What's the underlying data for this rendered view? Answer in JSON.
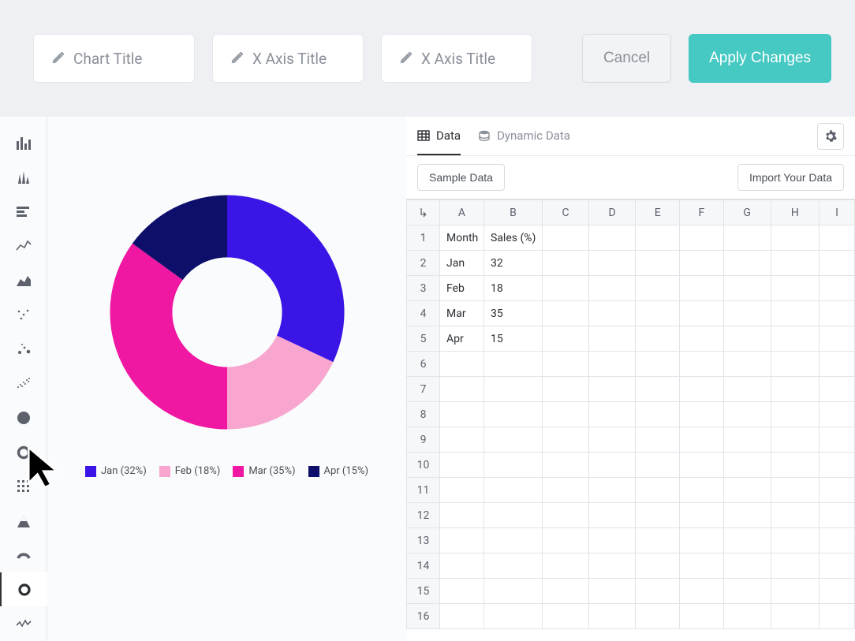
{
  "topbar": {
    "chart_title_placeholder": "Chart Title",
    "x_axis_placeholder": "X Axis Title",
    "y_axis_placeholder": "X Axis Title",
    "cancel_label": "Cancel",
    "apply_label": "Apply Changes"
  },
  "tabs": {
    "data": "Data",
    "dynamic": "Dynamic Data"
  },
  "toolbar": {
    "sample": "Sample Data",
    "import": "Import Your Data"
  },
  "sheet": {
    "columns": [
      "A",
      "B",
      "C",
      "D",
      "E",
      "F",
      "G",
      "H",
      "I"
    ],
    "headerRow": [
      "Month",
      "Sales (%)"
    ],
    "rows": [
      [
        "Jan",
        "32"
      ],
      [
        "Feb",
        "18"
      ],
      [
        "Mar",
        "35"
      ],
      [
        "Apr",
        "15"
      ]
    ],
    "visibleRowCount": 16
  },
  "chart_data": {
    "type": "pie",
    "title": "",
    "categories": [
      "Jan",
      "Feb",
      "Mar",
      "Apr"
    ],
    "values": [
      32,
      18,
      35,
      15
    ],
    "colors": [
      "#3a15e6",
      "#f8a6cf",
      "#f017a3",
      "#0e0f6b"
    ],
    "inner_radius_pct": 45,
    "legend_labels": [
      "Jan (32%)",
      "Feb (18%)",
      "Mar (35%)",
      "Apr (15%)"
    ]
  }
}
